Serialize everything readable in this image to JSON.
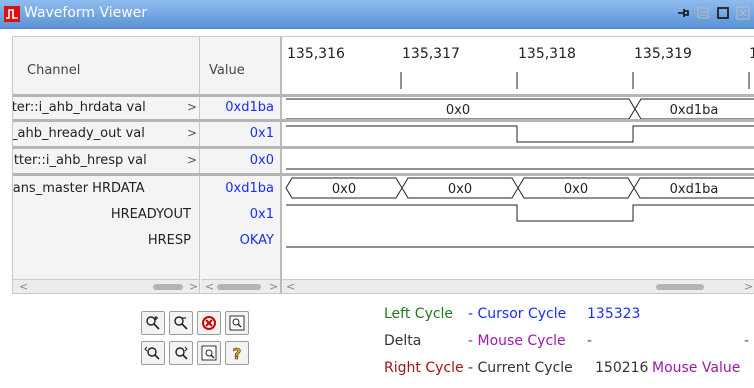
{
  "window": {
    "title": "Waveform Viewer"
  },
  "table": {
    "header_channel": "Channel",
    "header_value": "Value",
    "timeline_labels": [
      "135,316",
      "135,317",
      "135,318",
      "135,319",
      "1"
    ],
    "rows": [
      {
        "channel": "itter::i_ahb_hrdata val",
        "value": "0xd1ba",
        "bus_labels": [
          "0x0",
          "0xd1ba"
        ]
      },
      {
        "channel": ":i_ahb_hready_out val",
        "value": "0x1"
      },
      {
        "channel": "ilitter::i_ahb_hresp val",
        "value": "0x0"
      },
      {
        "channel": ":rans_master HRDATA",
        "value": "0xd1ba",
        "bus_labels": [
          "0x0",
          "0x0",
          "0x0",
          "0xd1ba"
        ]
      },
      {
        "channel": "HREADYOUT",
        "value": "0x1"
      },
      {
        "channel": "HRESP",
        "value": "OKAY"
      }
    ],
    "expand_marker": ">"
  },
  "scroll": {
    "left_arrow": "<",
    "right_arrow": ">"
  },
  "toolbar": {
    "icons": [
      "zoom-in-icon",
      "zoom-out-icon",
      "stop-icon",
      "zoom-fit-icon",
      "zoom-prev-icon",
      "zoom-next-icon",
      "zoom-area-icon",
      "help-icon"
    ]
  },
  "info": {
    "left_cycle_label": "Left Cycle",
    "cursor_cycle_label": "- Cursor Cycle",
    "cursor_cycle_value": "135323",
    "delta_label": "Delta",
    "mouse_cycle_label": "- Mouse Cycle",
    "mouse_cycle_value": "-",
    "trailing_dash": "-",
    "right_cycle_label": "Right Cycle",
    "current_cycle_label": "- Current Cycle",
    "current_cycle_value": "150216",
    "mouse_value_label": "Mouse Value"
  },
  "colors": {
    "title_bar": "#5b93d6",
    "value_text": "#1a2ef0",
    "left_cycle": "#1f7a1f",
    "mouse_cycle": "#9b1aa8",
    "right_cycle": "#a01515"
  }
}
